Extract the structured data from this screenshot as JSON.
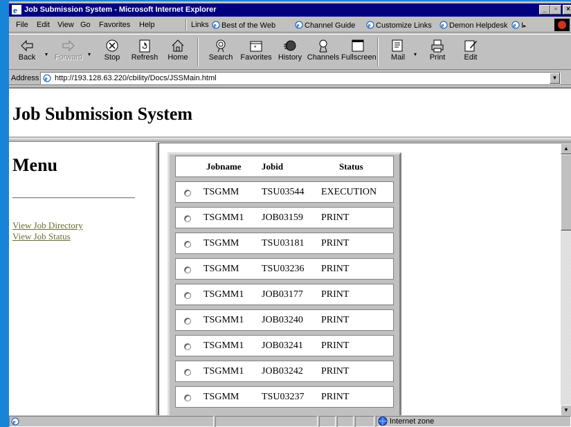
{
  "window": {
    "title": "Job Submission System - Microsoft Internet Explorer",
    "controls": {
      "minimize": "_",
      "maximize": "▫",
      "close": "×"
    }
  },
  "menubar": {
    "items": [
      "File",
      "Edit",
      "View",
      "Go",
      "Favorites",
      "Help"
    ],
    "links_label": "Links",
    "links": [
      "Best of the Web",
      "Channel Guide",
      "Customize Links",
      "Demon Helpdesk",
      "I"
    ]
  },
  "toolbar": {
    "buttons": [
      {
        "label": "Back",
        "icon": "back-arrow-icon"
      },
      {
        "label": "Forward",
        "icon": "forward-arrow-icon"
      },
      {
        "label": "Stop",
        "icon": "stop-icon"
      },
      {
        "label": "Refresh",
        "icon": "refresh-icon"
      },
      {
        "label": "Home",
        "icon": "home-icon"
      },
      {
        "label": "Search",
        "icon": "search-icon"
      },
      {
        "label": "Favorites",
        "icon": "favorites-icon"
      },
      {
        "label": "History",
        "icon": "history-icon"
      },
      {
        "label": "Channels",
        "icon": "channels-icon"
      },
      {
        "label": "Fullscreen",
        "icon": "fullscreen-icon"
      },
      {
        "label": "Mail",
        "icon": "mail-icon"
      },
      {
        "label": "Print",
        "icon": "print-icon"
      },
      {
        "label": "Edit",
        "icon": "edit-icon"
      }
    ]
  },
  "address": {
    "label": "Address",
    "url": "http://193.128.63.220/cbility/Docs/JSSMain.html"
  },
  "page": {
    "title": "Job Submission System",
    "menu": {
      "title": "Menu",
      "links": [
        "View Job Directory",
        "View Job Status"
      ]
    },
    "table": {
      "headers": [
        "Jobname",
        "Jobid",
        "Status"
      ],
      "rows": [
        [
          "TSGMM",
          "TSU03544",
          "EXECUTION"
        ],
        [
          "TSGMM1",
          "JOB03159",
          "PRINT"
        ],
        [
          "TSGMM",
          "TSU03181",
          "PRINT"
        ],
        [
          "TSGMM",
          "TSU03236",
          "PRINT"
        ],
        [
          "TSGMM1",
          "JOB03177",
          "PRINT"
        ],
        [
          "TSGMM1",
          "JOB03240",
          "PRINT"
        ],
        [
          "TSGMM1",
          "JOB03241",
          "PRINT"
        ],
        [
          "TSGMM1",
          "JOB03242",
          "PRINT"
        ],
        [
          "TSGMM",
          "TSU03237",
          "PRINT"
        ]
      ]
    }
  },
  "statusbar": {
    "zone": "Internet zone"
  },
  "colors": {
    "titlebar": "#000080",
    "chrome": "#c0c0c0",
    "desktop": "#1884d8",
    "visited_link": "#6a6a30"
  }
}
